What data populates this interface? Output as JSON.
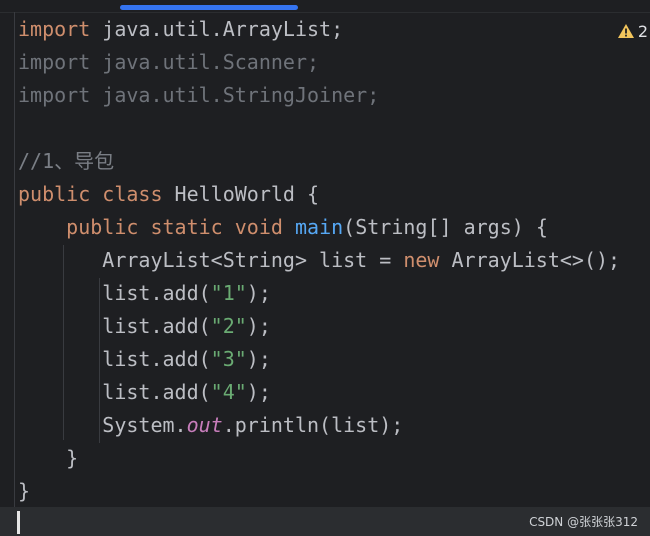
{
  "editor": {
    "warning_count": "2",
    "lines": {
      "l1": {
        "kw": "import",
        "rest": " java.util.ArrayList;"
      },
      "l2": {
        "kw": "import",
        "rest": " java.util.Scanner;"
      },
      "l3": {
        "kw": "import",
        "rest": " java.util.StringJoiner;"
      },
      "l5": {
        "comment": "//1、导包"
      },
      "l6": {
        "kw1": "public",
        "sp1": " ",
        "kw2": "class",
        "rest": " HelloWorld {"
      },
      "l7": {
        "indent": "    ",
        "kw1": "public",
        "sp1": " ",
        "kw2": "static",
        "sp2": " ",
        "kw3": "void",
        "sp3": " ",
        "fn": "main",
        "rest": "(String[] args) {"
      },
      "l8": {
        "indent": "       ",
        "a": "ArrayList<String> list = ",
        "kw": "new",
        "b": " ArrayList<>();"
      },
      "l9": {
        "indent": "       ",
        "a": "list.add(",
        "str": "\"1\"",
        "b": ");"
      },
      "l10": {
        "indent": "       ",
        "a": "list.add(",
        "str": "\"2\"",
        "b": ");"
      },
      "l11": {
        "indent": "       ",
        "a": "list.add(",
        "str": "\"3\"",
        "b": ");"
      },
      "l12": {
        "indent": "       ",
        "a": "list.add(",
        "str": "\"4\"",
        "b": ");"
      },
      "l13": {
        "indent": "       ",
        "a": "System.",
        "field": "out",
        "b": ".println(list);"
      },
      "l14": {
        "indent": "    ",
        "a": "}"
      },
      "l15": {
        "a": "}"
      }
    }
  },
  "watermark": "CSDN @张张张312",
  "colors": {
    "background": "#1e1f22",
    "keyword": "#cf8e6d",
    "function": "#56a8f5",
    "string": "#6aab73",
    "field": "#c77dbb",
    "comment": "#7a7e85",
    "tab_indicator": "#3574f0",
    "warning": "#f2c55c"
  }
}
